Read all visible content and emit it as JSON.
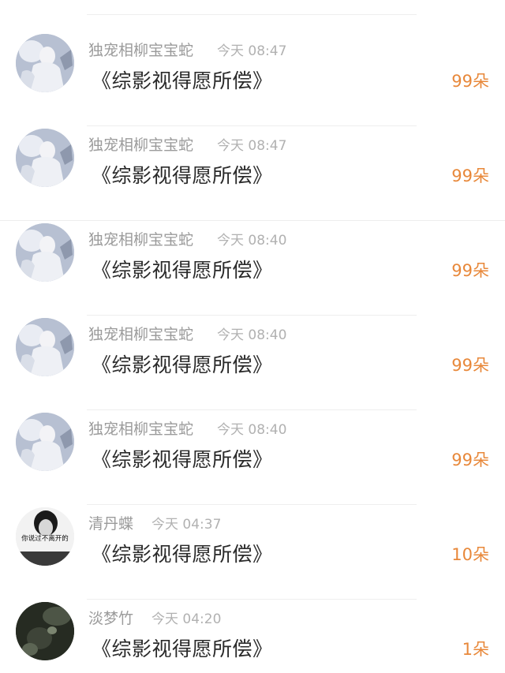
{
  "comments": [
    {
      "avatar": "white-robed-figure-avatar",
      "name": "独宠相柳宝宝蛇",
      "time": "今天 08:47",
      "book": "《综影视得愿所偿》",
      "gift": "99朵"
    },
    {
      "avatar": "white-robed-figure-avatar",
      "name": "独宠相柳宝宝蛇",
      "time": "今天 08:47",
      "book": "《综影视得愿所偿》",
      "gift": "99朵"
    },
    {
      "avatar": "white-robed-figure-avatar",
      "name": "独宠相柳宝宝蛇",
      "time": "今天 08:40",
      "book": "《综影视得愿所偿》",
      "gift": "99朵"
    },
    {
      "avatar": "white-robed-figure-avatar",
      "name": "独宠相柳宝宝蛇",
      "time": "今天 08:40",
      "book": "《综影视得愿所偿》",
      "gift": "99朵"
    },
    {
      "avatar": "white-robed-figure-avatar",
      "name": "独宠相柳宝宝蛇",
      "time": "今天 08:40",
      "book": "《综影视得愿所偿》",
      "gift": "99朵"
    },
    {
      "avatar": "black-white-portrait-avatar",
      "avatar_text": "你说过不离开的",
      "name": "清丹蝶",
      "time": "今天 04:37",
      "book": "《综影视得愿所偿》",
      "gift": "10朵"
    },
    {
      "avatar": "dark-nature-avatar",
      "name": "淡梦竹",
      "time": "今天 04:20",
      "book": "《综影视得愿所偿》",
      "gift": "1朵"
    }
  ],
  "colors": {
    "gift": "#e8883a",
    "name": "#9b9b9b",
    "time": "#b1b1b1",
    "book": "#2a2a2a",
    "divider": "#eeeeee"
  }
}
